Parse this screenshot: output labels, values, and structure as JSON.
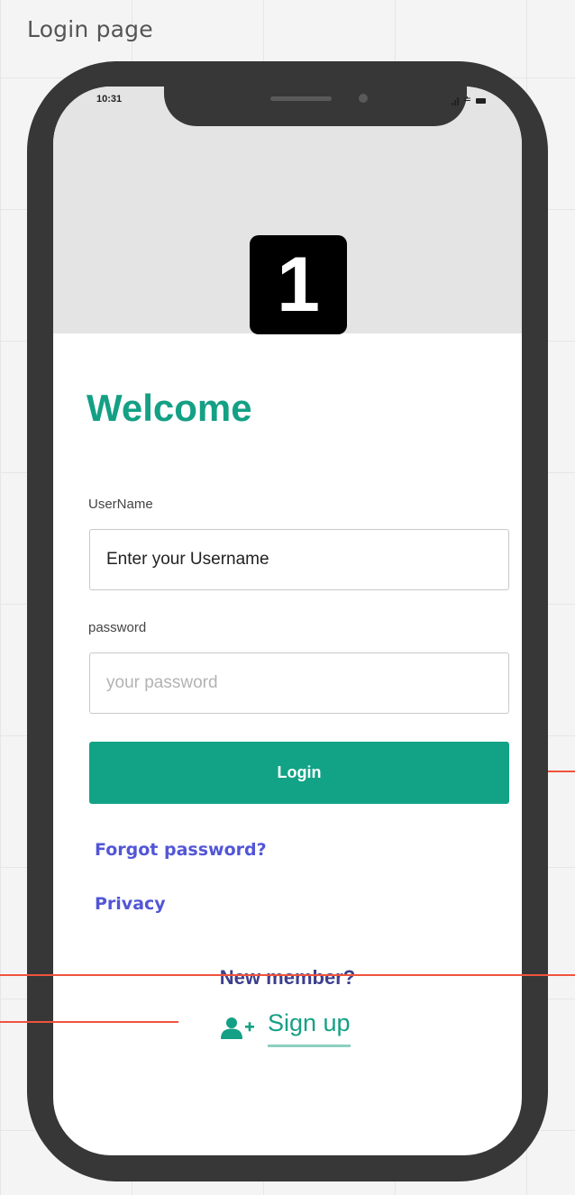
{
  "canvas": {
    "title": "Login page"
  },
  "status_bar": {
    "time": "10:31"
  },
  "logo": {
    "text": "1"
  },
  "welcome": {
    "title": "Welcome"
  },
  "username": {
    "label": "UserName",
    "value": "Enter your Username",
    "placeholder": ""
  },
  "password": {
    "label": "password",
    "value": "",
    "placeholder": "your password"
  },
  "login_button": {
    "label": "Login"
  },
  "links": {
    "forgot_password": "Forgot password?",
    "privacy": "Privacy"
  },
  "signup": {
    "prompt": "New member?",
    "label": "Sign up"
  },
  "icons": [
    "signal-icon",
    "wifi-icon",
    "battery-icon",
    "user-plus-icon"
  ],
  "colors": {
    "brand_green": "#14a085",
    "button_green": "#12a386",
    "link_blue": "#5256d6",
    "prompt_navy": "#3c3f8d",
    "phone_frame": "#373737",
    "header_gray": "#e4e4e4",
    "connector_red": "#f0533d"
  }
}
